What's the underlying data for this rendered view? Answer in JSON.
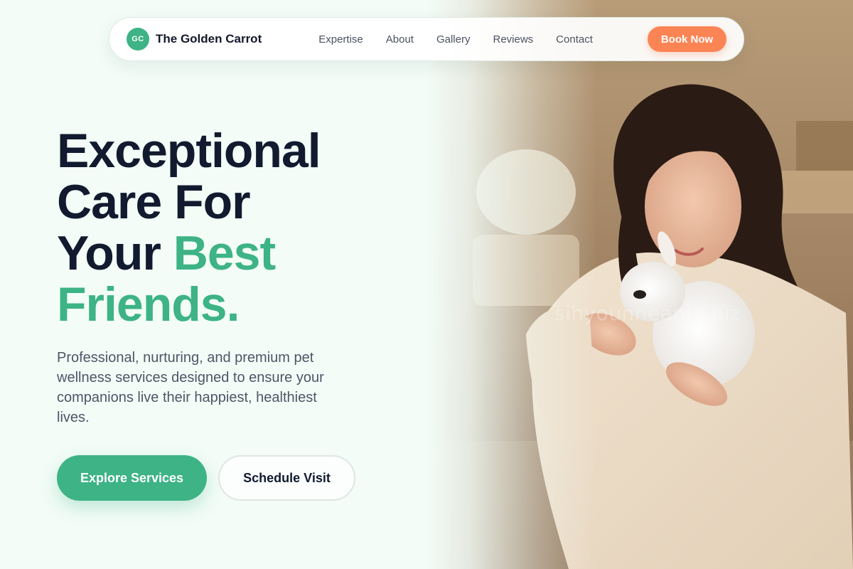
{
  "brand": {
    "logo_initials": "GC",
    "name": "The Golden Carrot"
  },
  "nav": {
    "links": [
      "Expertise",
      "About",
      "Gallery",
      "Reviews",
      "Contact"
    ],
    "cta_label": "Book Now"
  },
  "hero": {
    "headline_line1": "Exceptional",
    "headline_line2": "Care For",
    "headline_line3_a": "Your ",
    "headline_line3_b": "Best",
    "headline_line4_a": "Friends",
    "headline_line4_b": ".",
    "subtext": "Professional, nurturing, and premium pet wellness services designed to ensure your companions live their happiest, healthiest lives.",
    "primary_button": "Explore Services",
    "secondary_button": "Schedule Visit",
    "image_watermark": "sihyounneanig.biz"
  },
  "colors": {
    "accent_green": "#3db386",
    "cta_orange": "#fb8455",
    "heading_dark": "#111a2e",
    "background": "#f3fcf7"
  },
  "icons": [
    "logo-badge-icon"
  ]
}
